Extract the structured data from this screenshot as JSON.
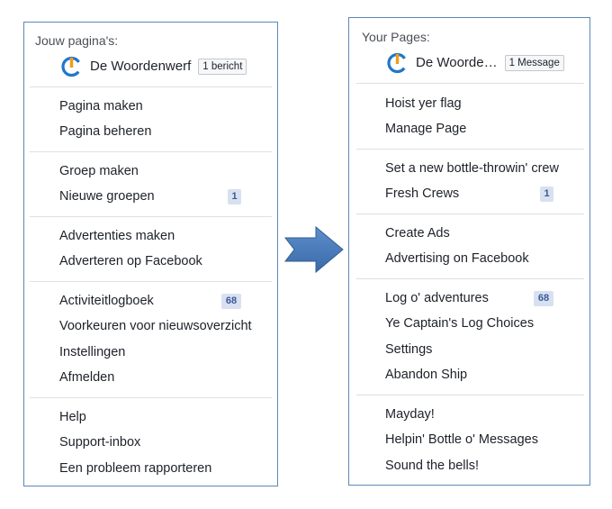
{
  "left": {
    "header": "Jouw pagina's:",
    "page_name": "De Woordenwerf",
    "message_badge": "1 bericht",
    "groups": [
      [
        "Pagina maken",
        "Pagina beheren"
      ],
      [
        "Groep maken",
        "Nieuwe groepen"
      ],
      [
        "Advertenties maken",
        "Adverteren op Facebook"
      ],
      [
        "Activiteitlogboek",
        "Voorkeuren voor nieuwsoverzicht",
        "Instellingen",
        "Afmelden"
      ],
      [
        "Help",
        "Support-inbox",
        "Een probleem rapporteren"
      ]
    ],
    "badge_new_groups": "1",
    "badge_activity": "68"
  },
  "right": {
    "header": "Your Pages:",
    "page_name": "De Woorde…",
    "message_badge": "1 Message",
    "groups": [
      [
        "Hoist yer flag",
        "Manage Page"
      ],
      [
        "Set a new bottle-throwin' crew",
        "Fresh Crews"
      ],
      [
        "Create Ads",
        "Advertising on Facebook"
      ],
      [
        "Log o' adventures",
        "Ye Captain's Log Choices",
        "Settings",
        "Abandon Ship"
      ],
      [
        "Mayday!",
        "Helpin' Bottle o' Messages",
        "Sound the bells!"
      ]
    ],
    "badge_fresh_crews": "1",
    "badge_log": "68"
  },
  "colors": {
    "border": "#5b89b5",
    "badge_bg": "#d8e1f0",
    "badge_text": "#3b5998",
    "arrow": "#4a7ebb",
    "icon_blue": "#1f77c8",
    "icon_orange": "#f39a1c"
  },
  "icons": {
    "page_logo": "power-logo-icon",
    "transition": "right-arrow-icon"
  }
}
